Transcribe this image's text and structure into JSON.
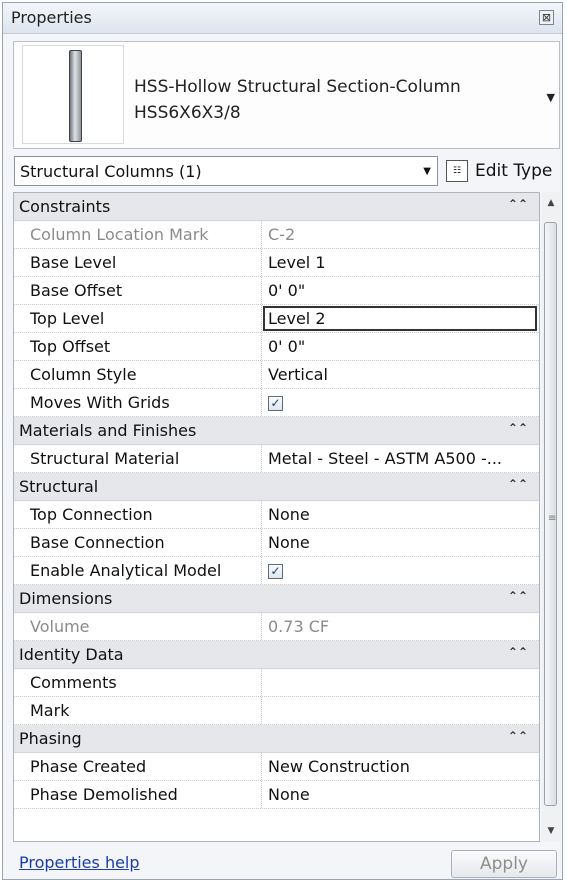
{
  "window": {
    "title": "Properties",
    "close_glyph": "⊠"
  },
  "type_selector": {
    "family": "HSS-Hollow Structural Section-Column",
    "type": "HSS6X6X3/8",
    "dropdown_icon": "triangle-down-icon"
  },
  "filter": {
    "value": "Structural Columns (1)"
  },
  "edit_type": {
    "label": "Edit Type",
    "icon": "edit-type-icon"
  },
  "groups": {
    "constraints": {
      "label": "Constraints",
      "rows": [
        {
          "name": "Column Location Mark",
          "value": "C-2",
          "readonly": true
        },
        {
          "name": "Base Level",
          "value": "Level 1"
        },
        {
          "name": "Base Offset",
          "value": "0'  0\""
        },
        {
          "name": "Top Level",
          "value": "Level 2",
          "editing": true
        },
        {
          "name": "Top Offset",
          "value": "0'  0\""
        },
        {
          "name": "Column Style",
          "value": "Vertical"
        },
        {
          "name": "Moves With Grids",
          "checked": true
        }
      ]
    },
    "materials": {
      "label": "Materials and Finishes",
      "rows": [
        {
          "name": "Structural Material",
          "value": "Metal - Steel - ASTM A500 -..."
        }
      ]
    },
    "structural": {
      "label": "Structural",
      "rows": [
        {
          "name": "Top Connection",
          "value": "None"
        },
        {
          "name": "Base Connection",
          "value": "None"
        },
        {
          "name": "Enable Analytical Model",
          "checked": true
        }
      ]
    },
    "dimensions": {
      "label": "Dimensions",
      "rows": [
        {
          "name": "Volume",
          "value": "0.73 CF",
          "readonly": true
        }
      ]
    },
    "identity": {
      "label": "Identity Data",
      "rows": [
        {
          "name": "Comments",
          "value": ""
        },
        {
          "name": "Mark",
          "value": ""
        }
      ]
    },
    "phasing": {
      "label": "Phasing",
      "rows": [
        {
          "name": "Phase Created",
          "value": "New Construction"
        },
        {
          "name": "Phase Demolished",
          "value": "None"
        }
      ]
    }
  },
  "footer": {
    "help_link": "Properties help",
    "apply_label": "Apply",
    "apply_enabled": false
  }
}
